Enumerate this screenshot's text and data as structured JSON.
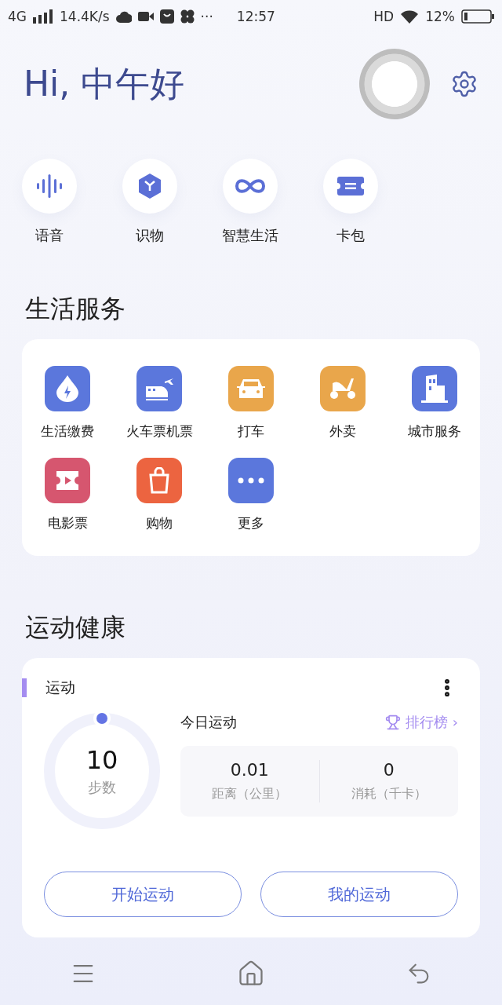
{
  "status_bar": {
    "network": "4G",
    "speed": "14.4K/s",
    "more": "···",
    "time": "12:57",
    "hd": "HD",
    "battery": "12%"
  },
  "header": {
    "greeting": "Hi, 中午好"
  },
  "quick_actions": [
    {
      "label": "语音"
    },
    {
      "label": "识物"
    },
    {
      "label": "智慧生活"
    },
    {
      "label": "卡包"
    }
  ],
  "life_services": {
    "title": "生活服务",
    "items": [
      {
        "label": "生活缴费",
        "color": "#5b77dc"
      },
      {
        "label": "火车票机票",
        "color": "#5b77dc"
      },
      {
        "label": "打车",
        "color": "#e9a64b"
      },
      {
        "label": "外卖",
        "color": "#e9a64b"
      },
      {
        "label": "城市服务",
        "color": "#5b77dc"
      },
      {
        "label": "电影票",
        "color": "#d6566f"
      },
      {
        "label": "购物",
        "color": "#ec6440"
      },
      {
        "label": "更多",
        "color": "#5b77dc"
      }
    ]
  },
  "sports_health": {
    "title": "运动健康",
    "card": {
      "title": "运动",
      "steps": "10",
      "steps_label": "步数",
      "today": "今日运动",
      "ranking": "排行榜",
      "chevron": "›",
      "stats": [
        {
          "value": "0.01",
          "label": "距离（公里）"
        },
        {
          "value": "0",
          "label": "消耗（千卡）"
        }
      ],
      "buttons": [
        "开始运动",
        "我的运动"
      ]
    }
  }
}
